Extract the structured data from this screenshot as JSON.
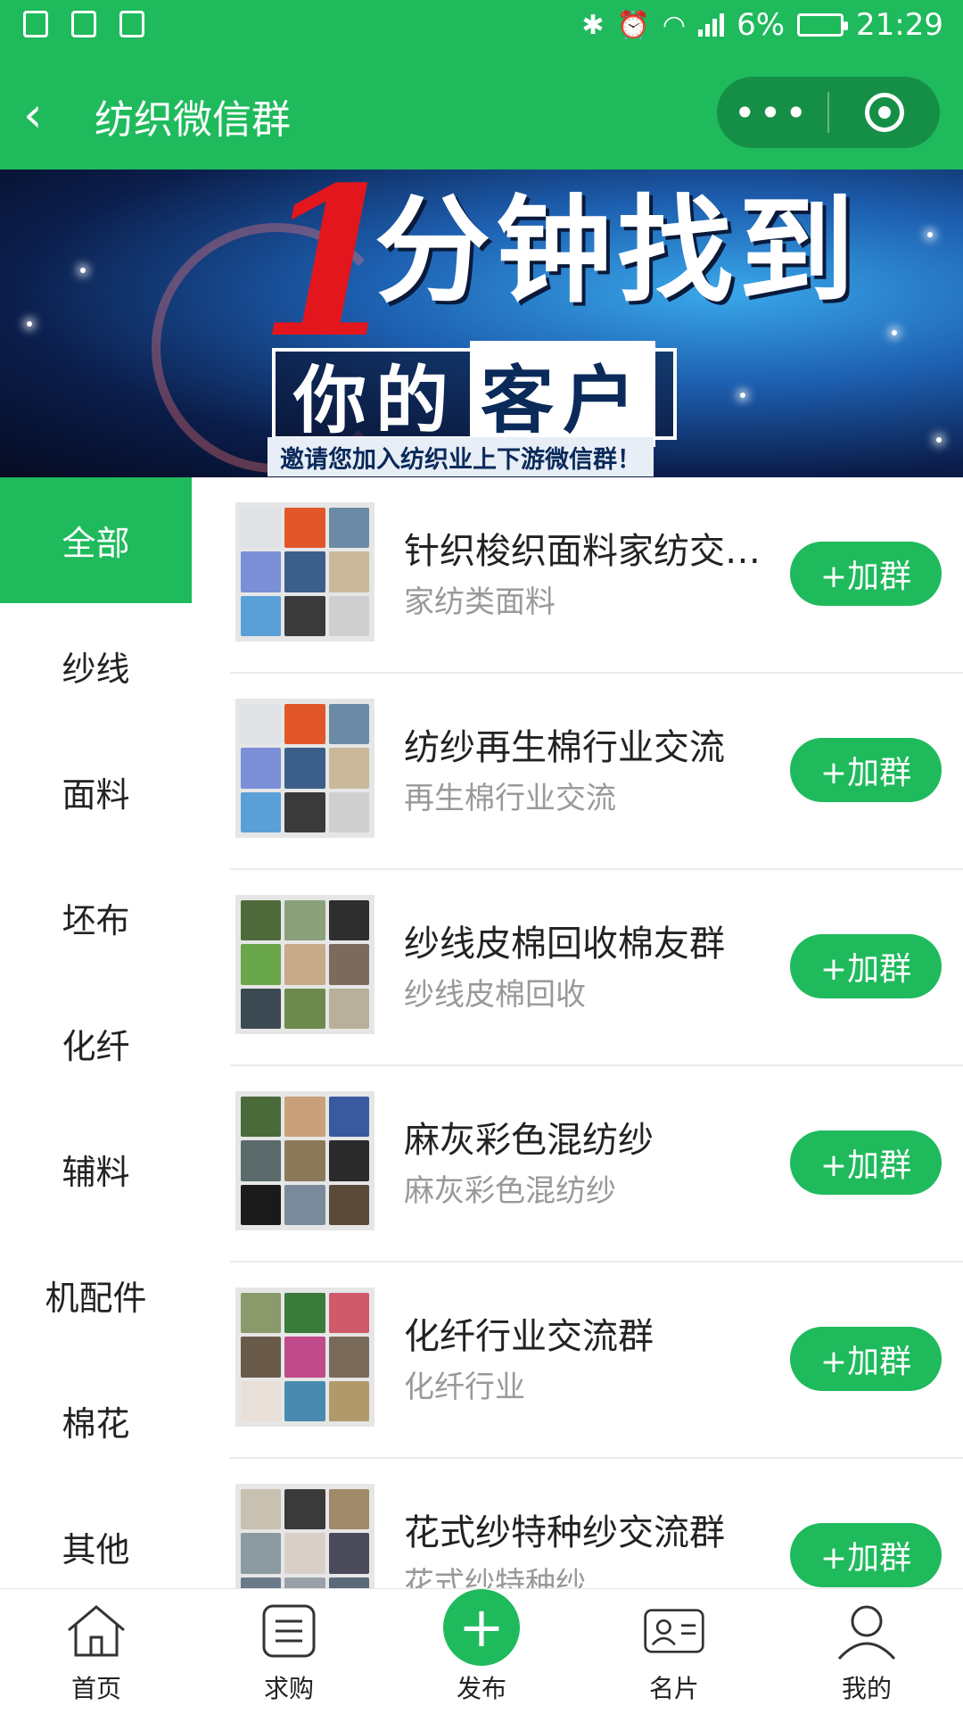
{
  "status_bar": {
    "left_icons": [
      "trash-icon",
      "alert-icon",
      "image-icon"
    ],
    "battery": "6%",
    "time": "21:29",
    "right_icons": [
      "bluetooth-icon",
      "alarm-icon",
      "wifi-icon",
      "signal-icon",
      "battery-icon"
    ]
  },
  "nav": {
    "back_icon": "‹",
    "title": "纺织微信群",
    "more_icon": "•••"
  },
  "banner": {
    "one": "1",
    "headline": "分钟找到",
    "line2_a": "你的",
    "line2_b": "客户",
    "subtitle": "邀请您加入纺织业上下游微信群！"
  },
  "sidebar": {
    "items": [
      {
        "label": "全部",
        "active": true
      },
      {
        "label": "纱线"
      },
      {
        "label": "面料"
      },
      {
        "label": "坯布"
      },
      {
        "label": "化纤"
      },
      {
        "label": "辅料"
      },
      {
        "label": "机配件"
      },
      {
        "label": "棉花"
      },
      {
        "label": "其他"
      }
    ]
  },
  "groups": [
    {
      "name": "针织梭织面料家纺交流群",
      "desc": "家纺类面料",
      "join_label": "+加群"
    },
    {
      "name": "纺纱再生棉行业交流",
      "desc": "再生棉行业交流",
      "join_label": "+加群"
    },
    {
      "name": "纱线皮棉回收棉友群",
      "desc": "纱线皮棉回收",
      "join_label": "+加群"
    },
    {
      "name": "麻灰彩色混纺纱",
      "desc": "麻灰彩色混纺纱",
      "join_label": "+加群"
    },
    {
      "name": "化纤行业交流群",
      "desc": "化纤行业",
      "join_label": "+加群"
    },
    {
      "name": "花式纱特种纱交流群",
      "desc": "花式纱特种纱",
      "join_label": "+加群"
    }
  ],
  "tabbar": {
    "items": [
      {
        "label": "首页",
        "icon": "home-icon"
      },
      {
        "label": "求购",
        "icon": "list-icon"
      },
      {
        "label": "发布",
        "icon": "plus-icon"
      },
      {
        "label": "名片",
        "icon": "card-icon"
      },
      {
        "label": "我的",
        "icon": "user-icon"
      }
    ]
  },
  "colors": {
    "brand_green": "#1fba5c",
    "capsule_green": "#168f46"
  }
}
